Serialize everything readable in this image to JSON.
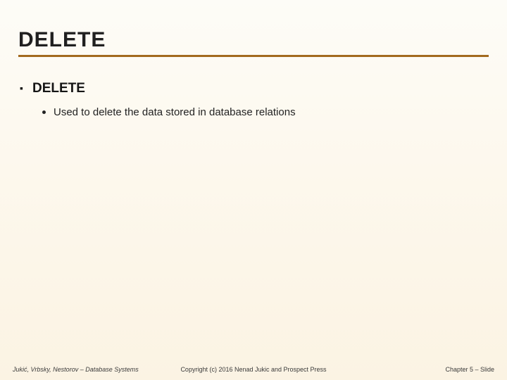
{
  "title": "DELETE",
  "bullets": {
    "level1": "DELETE",
    "level2": "Used to delete the data stored in database relations"
  },
  "footer": {
    "left": "Jukić, Vrbsky, Nestorov – Database Systems",
    "center": "Copyright (c) 2016 Nenad Jukic and Prospect Press",
    "right": "Chapter 5 – Slide"
  }
}
